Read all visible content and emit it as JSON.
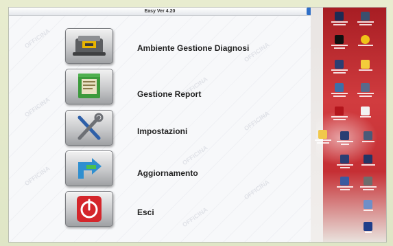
{
  "app": {
    "title": "Easy Ver 4.20"
  },
  "menu": {
    "items": [
      {
        "name": "ambiente-gestione-diagnosi",
        "label": "Ambiente Gestione Diagnosi",
        "icon": "printer-icon"
      },
      {
        "name": "gestione-report",
        "label": "Gestione Report",
        "icon": "folder-report-icon"
      },
      {
        "name": "impostazioni",
        "label": "Impostazioni",
        "icon": "tools-icon"
      },
      {
        "name": "aggiornamento",
        "label": "Aggiornamento",
        "icon": "update-arrow-icon"
      },
      {
        "name": "esci",
        "label": "Esci",
        "icon": "power-icon"
      }
    ]
  },
  "colors": {
    "accent_blue": "#2f6fc7",
    "desktop_red": "#c52f34",
    "power_red": "#d4262b",
    "report_green": "#3c9a3c"
  }
}
